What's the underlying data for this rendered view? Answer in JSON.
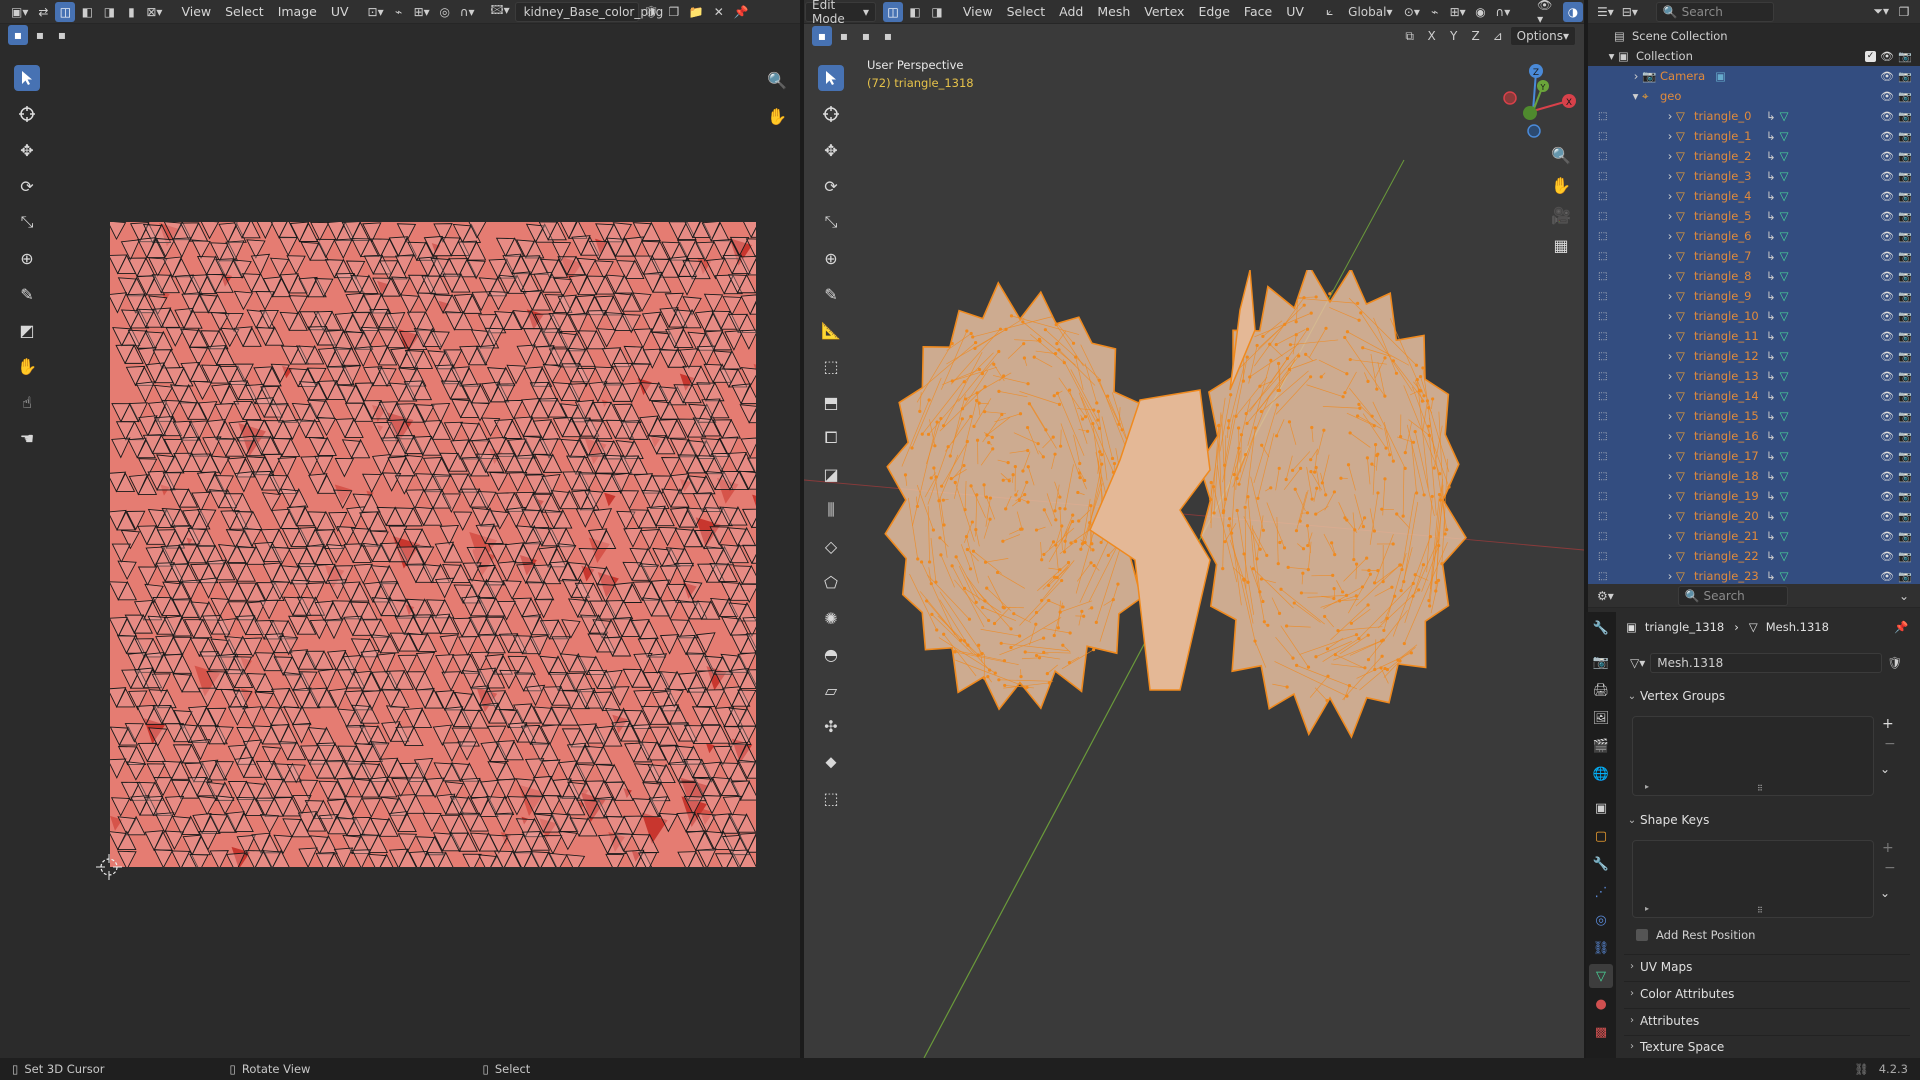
{
  "uv_editor": {
    "menus": [
      "View",
      "Select",
      "Image",
      "UV"
    ],
    "image_name": "kidney_Base_color_png"
  },
  "viewport": {
    "mode": "Edit Mode",
    "menus": [
      "View",
      "Select",
      "Add",
      "Mesh",
      "Vertex",
      "Edge",
      "Face",
      "UV"
    ],
    "orientation": "Global",
    "axes": [
      "X",
      "Y",
      "Z"
    ],
    "options_label": "Options",
    "overlay_title": "User Perspective",
    "overlay_object": "(72) triangle_1318",
    "gizmo": {
      "x": "X",
      "y": "Y",
      "z": "Z"
    }
  },
  "outliner": {
    "search_placeholder": "Search",
    "scene_collection": "Scene Collection",
    "collection": "Collection",
    "camera": "Camera",
    "geo": "geo",
    "objects": [
      "triangle_0",
      "triangle_1",
      "triangle_2",
      "triangle_3",
      "triangle_4",
      "triangle_5",
      "triangle_6",
      "triangle_7",
      "triangle_8",
      "triangle_9",
      "triangle_10",
      "triangle_11",
      "triangle_12",
      "triangle_13",
      "triangle_14",
      "triangle_15",
      "triangle_16",
      "triangle_17",
      "triangle_18",
      "triangle_19",
      "triangle_20",
      "triangle_21",
      "triangle_22",
      "triangle_23"
    ]
  },
  "properties": {
    "search_placeholder": "Search",
    "breadcrumb_object": "triangle_1318",
    "breadcrumb_mesh": "Mesh.1318",
    "mesh_name": "Mesh.1318",
    "sections": {
      "vertex_groups": "Vertex Groups",
      "shape_keys": "Shape Keys",
      "add_rest_position": "Add Rest Position",
      "uv_maps": "UV Maps",
      "color_attributes": "Color Attributes",
      "attributes": "Attributes",
      "texture_space": "Texture Space"
    }
  },
  "statusbar": {
    "left": "Set 3D Cursor",
    "middle": "Rotate View",
    "right": "Select",
    "version": "4.2.3"
  },
  "colors": {
    "accent": "#4772b3",
    "selected_row": "#334d80",
    "mesh_orange": "#f08a1e",
    "uv_background": "#e57c72"
  }
}
